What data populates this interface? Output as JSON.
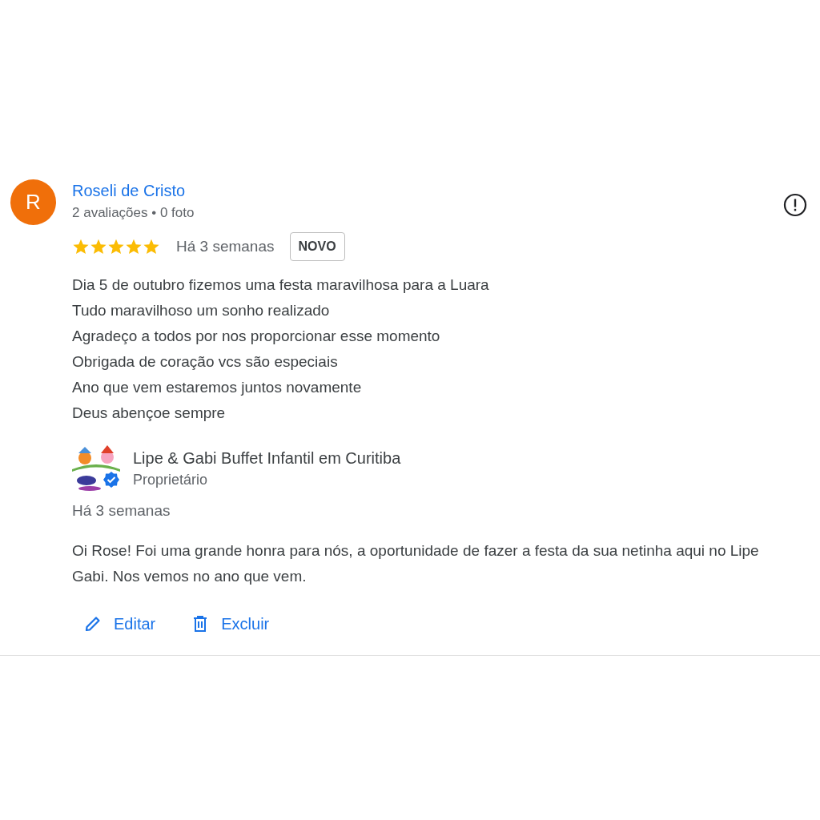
{
  "review": {
    "avatar_letter": "R",
    "author": "Roseli de Cristo",
    "meta": "2 avaliações • 0 foto",
    "stars": 5,
    "time": "Há 3 semanas",
    "badge": "NOVO",
    "lines": [
      "Dia 5 de outubro fizemos uma festa maravilhosa para a Luara",
      "Tudo maravilhoso um sonho realizado",
      "Agradeço a todos por nos proporcionar esse momento",
      "Obrigada de coração vcs são especiais",
      "Ano que vem estaremos juntos novamente",
      "Deus abençoe sempre"
    ]
  },
  "owner_reply": {
    "name": "Lipe & Gabi Buffet Infantil em Curitiba",
    "role": "Proprietário",
    "verified": true,
    "time": "Há 3 semanas",
    "text": "Oi Rose! Foi uma grande honra para nós, a oportunidade de fazer a festa da sua netinha aqui no Lipe Gabi. Nos vemos no ano que vem."
  },
  "actions": [
    {
      "kind": "edit",
      "label": "Editar"
    },
    {
      "kind": "delete",
      "label": "Excluir"
    }
  ]
}
